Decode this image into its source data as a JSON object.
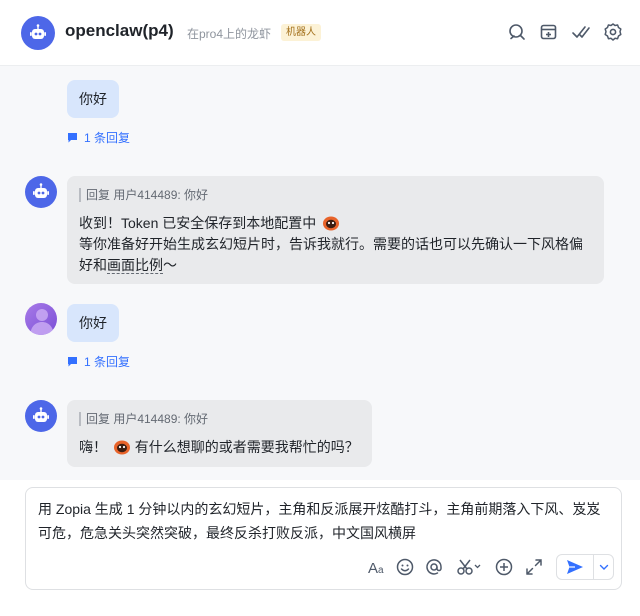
{
  "header": {
    "title": "openclaw(p4)",
    "subtitle": "在pro4上的龙虾",
    "badge": "机器人",
    "icons": [
      "search-icon",
      "add-tab-icon",
      "check-icon",
      "settings-icon"
    ]
  },
  "messages": [
    {
      "kind": "own",
      "text": "你好",
      "reply_count": "1 条回复"
    },
    {
      "kind": "bot",
      "quote": "回复 用户414489: 你好",
      "line1": "收到！Token 已安全保存到本地配置中",
      "line2": "等你准备好开始生成玄幻短片时，告诉我就行。需要的话也可以先确认一下风格偏",
      "line3_a": "好和",
      "line3_b": "画面比例",
      "line3_c": "～"
    },
    {
      "kind": "user",
      "text": "你好",
      "reply_count": "1 条回复"
    },
    {
      "kind": "bot",
      "quote": "回复 用户414489: 你好",
      "line1_a": "嗨！",
      "line1_b": "有什么想聊的或者需要我帮忙的吗？"
    }
  ],
  "composer": {
    "value": "用 Zopia 生成 1 分钟以内的玄幻短片，主角和反派展开炫酷打斗，主角前期落入下风、岌岌可危，危急关头突然突破，最终反杀打败反派，中文国风横屏",
    "toolbar_icons": [
      "text-format-icon",
      "emoji-icon",
      "mention-icon",
      "scissors-icon",
      "add-icon",
      "expand-icon",
      "send-icon",
      "dropdown-icon"
    ]
  },
  "colors": {
    "accent": "#3370ff",
    "bot_avatar": "#4d67e8",
    "own_bubble": "#d8e6fc",
    "bot_bubble": "#e9eaec"
  }
}
